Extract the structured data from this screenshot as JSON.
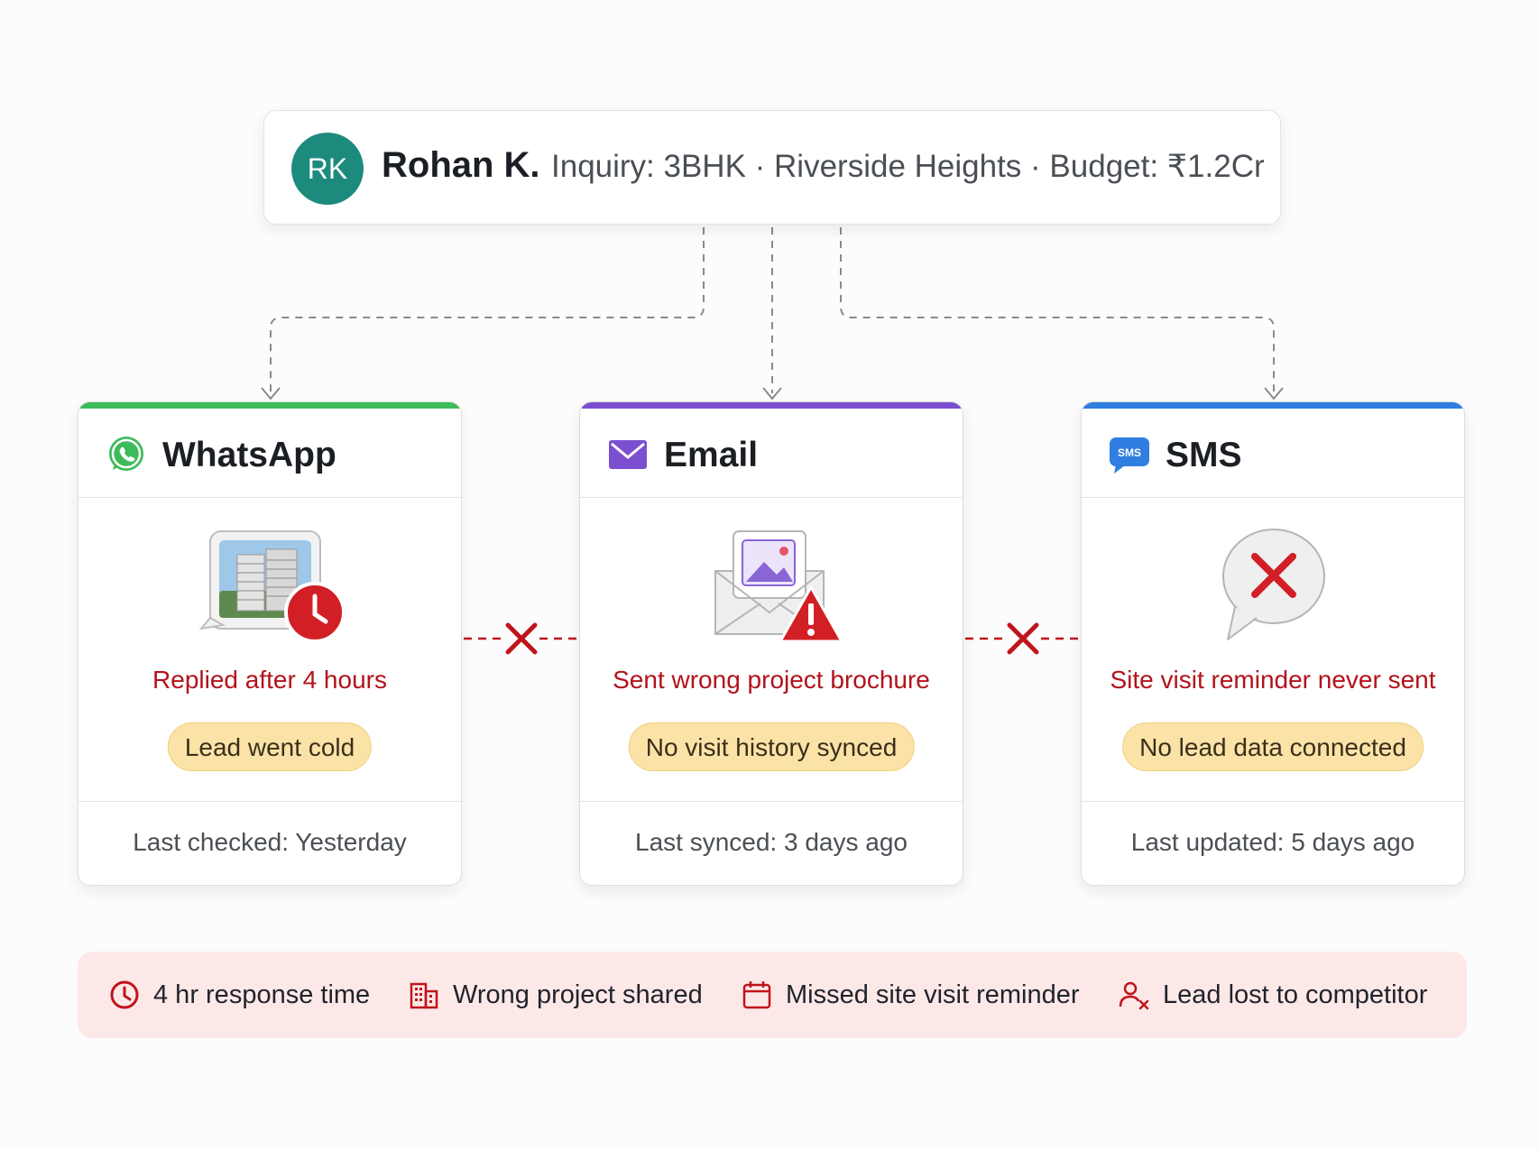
{
  "lead": {
    "initials": "RK",
    "name": "Rohan K.",
    "inquiry": "Inquiry: 3BHK · Riverside Heights · Budget: ₹1.2Cr",
    "avatar_color": "#1d8a7e"
  },
  "channels": [
    {
      "title": "WhatsApp",
      "icon": "whatsapp-icon",
      "accent": "#3dbb5a",
      "illustration": "building-photo-with-clock-icon",
      "issue": "Replied after 4 hours",
      "pill": "Lead went cold",
      "footer": "Last checked: Yesterday"
    },
    {
      "title": "Email",
      "icon": "envelope-icon",
      "accent": "#7b4fd0",
      "illustration": "envelope-with-warning-icon",
      "issue": "Sent wrong project brochure",
      "pill": "No visit history synced",
      "footer": "Last synced: 3 days ago"
    },
    {
      "title": "SMS",
      "icon": "sms-bubble-icon",
      "sms_badge": "SMS",
      "accent": "#2f7ee0",
      "illustration": "speech-bubble-with-x-icon",
      "issue": "Site visit reminder never sent",
      "pill": "No lead data connected",
      "footer": "Last updated: 5 days ago"
    }
  ],
  "summary": [
    {
      "icon": "clock-icon",
      "text": "4 hr response time"
    },
    {
      "icon": "building-icon",
      "text": "Wrong project shared"
    },
    {
      "icon": "calendar-icon",
      "text": "Missed site visit reminder"
    },
    {
      "icon": "user-x-icon",
      "text": "Lead lost to competitor"
    }
  ],
  "colors": {
    "issue_red": "#b3121b",
    "pill_bg": "#fbe3a8",
    "summary_bg": "#fde8e8",
    "connector_gray": "#8a8a8a"
  }
}
